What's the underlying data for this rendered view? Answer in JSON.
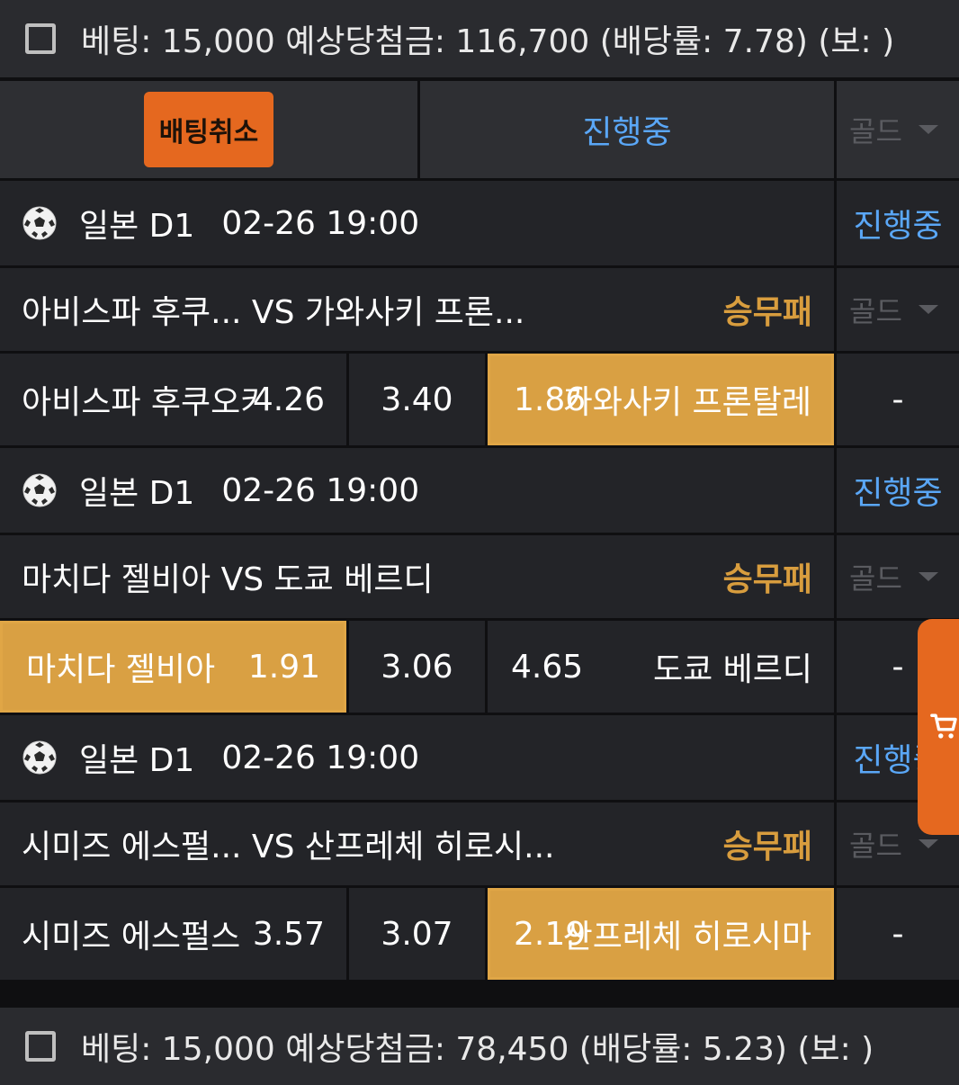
{
  "summary_top": {
    "text": "베팅: 15,000 예상당첨금: 116,700 (배당률: 7.78) (보: )"
  },
  "header": {
    "cancel_label": "배팅취소",
    "status_label": "진행중",
    "gold_label": "골드"
  },
  "matches": [
    {
      "league": "일본 D1",
      "datetime": "02-26 19:00",
      "status": "진행중",
      "teams": "아비스파 후쿠...   VS 가와사키 프론...",
      "market": "승무패",
      "gold": "골드",
      "home_label": "아비스파 후쿠오카",
      "home_odd": "4.26",
      "draw_odd": "3.40",
      "away_odd": "1.86",
      "away_label": "가와사키 프론탈레",
      "extra": "-",
      "selected": "away"
    },
    {
      "league": "일본 D1",
      "datetime": "02-26 19:00",
      "status": "진행중",
      "teams": "마치다 젤비아 VS 도쿄 베르디",
      "market": "승무패",
      "gold": "골드",
      "home_label": "마치다 젤비아",
      "home_odd": "1.91",
      "draw_odd": "3.06",
      "away_odd": "4.65",
      "away_label": "도쿄 베르디",
      "extra": "-",
      "selected": "home"
    },
    {
      "league": "일본 D1",
      "datetime": "02-26 19:00",
      "status": "진행중",
      "teams": "시미즈 에스펄...  VS 산프레체 히로시...",
      "market": "승무패",
      "gold": "골드",
      "home_label": "시미즈 에스펄스",
      "home_odd": "3.57",
      "draw_odd": "3.07",
      "away_odd": "2.19",
      "away_label": "산프레체 히로시마",
      "extra": "-",
      "selected": "away"
    }
  ],
  "summary_bottom": {
    "text": "베팅: 15,000 예상당첨금: 78,450 (배당률: 5.23) (보: )"
  },
  "colors": {
    "accent_orange": "#e5681f",
    "gold_selected": "#d9a043",
    "status_blue": "#5aa7f7",
    "market_gold": "#d89d3e"
  },
  "icons": {
    "ball": "soccer-ball-icon",
    "cart": "shopping-cart-icon",
    "checkbox": "checkbox-icon"
  }
}
